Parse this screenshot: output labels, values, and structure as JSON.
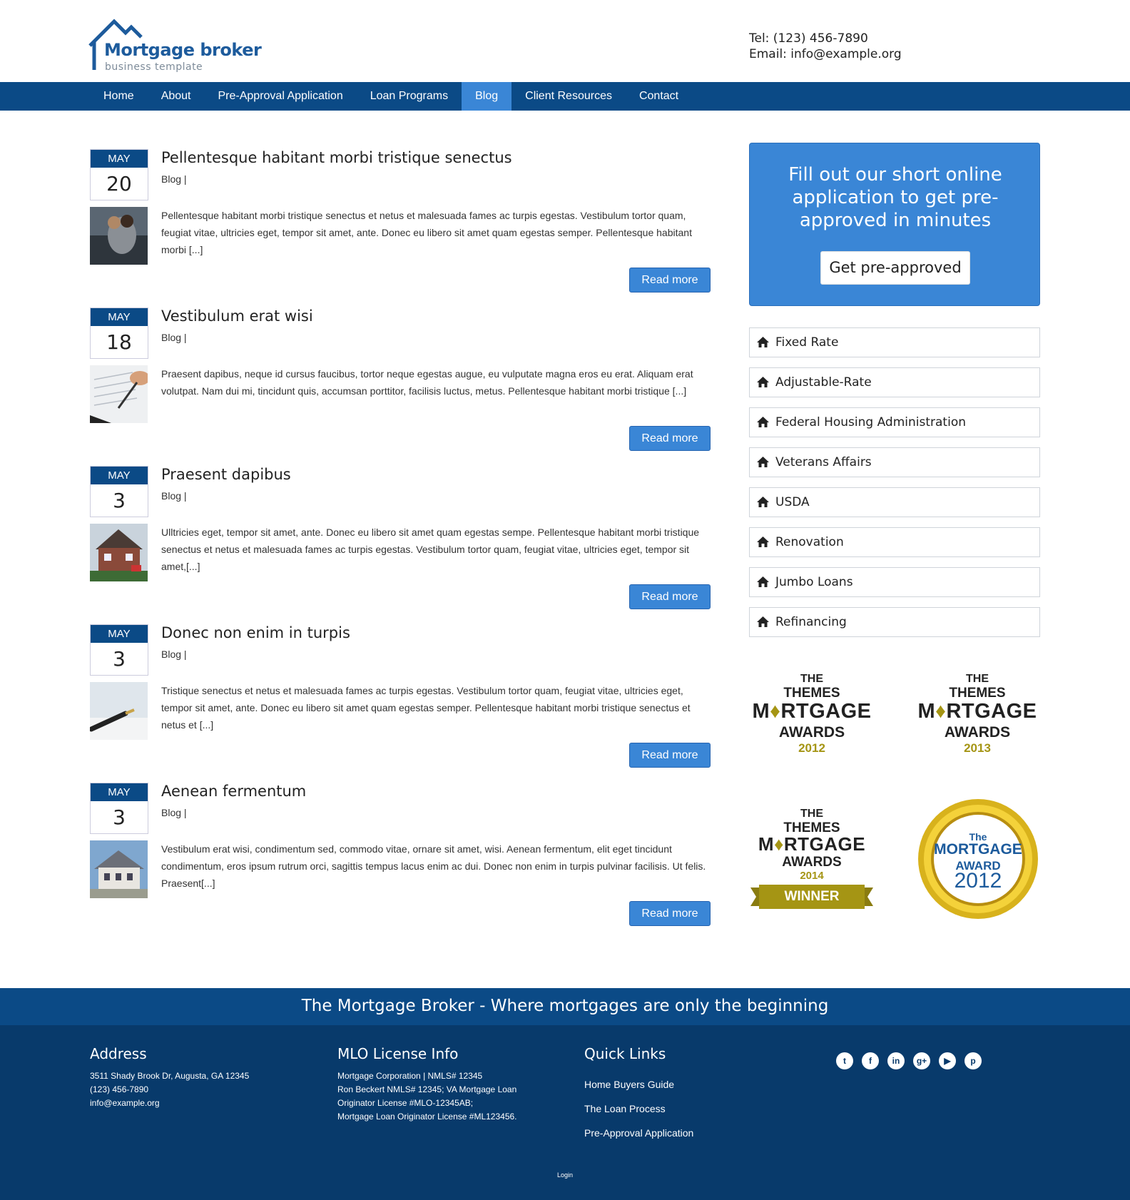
{
  "brand": {
    "title": "Mortgage broker",
    "subtitle": "business template",
    "primary_color": "#0b4a86",
    "accent_color": "#3a86d6",
    "gold_color": "#a59514"
  },
  "contact": {
    "tel": "Tel: (123) 456-7890",
    "email": "Email: info@example.org"
  },
  "nav": {
    "items": [
      {
        "label": "Home"
      },
      {
        "label": "About"
      },
      {
        "label": "Pre-Approval Application"
      },
      {
        "label": "Loan Programs"
      },
      {
        "label": "Blog",
        "active": true
      },
      {
        "label": "Client Resources"
      },
      {
        "label": "Contact"
      }
    ]
  },
  "posts": [
    {
      "month": "MAY",
      "day": "20",
      "title": "Pellentesque habitant morbi tristique senectus",
      "category": "Blog |",
      "excerpt": "Pellentesque habitant morbi tristique senectus et netus et malesuada fames ac turpis egestas. Vestibulum tortor quam, feugiat vitae, ultricies eget, tempor sit amet, ante. Donec eu libero sit amet quam egestas semper. Pellentesque habitant morbi [...]",
      "read_more": "Read more",
      "thumb_icon": "couple-photo"
    },
    {
      "month": "MAY",
      "day": "18",
      "title": "Vestibulum erat wisi",
      "category": "Blog |",
      "excerpt": "Praesent dapibus, neque id cursus faucibus, tortor neque egestas augue, eu vulputate magna eros eu erat. Aliquam erat volutpat. Nam dui mi, tincidunt quis, accumsan porttitor, facilisis luctus, metus. Pellentesque habitant morbi tristique [...]",
      "read_more": "Read more",
      "thumb_icon": "signing-document-photo"
    },
    {
      "month": "MAY",
      "day": "3",
      "title": "Praesent dapibus",
      "category": "Blog |",
      "excerpt": "Ulltricies eget, tempor sit amet, ante. Donec eu libero sit amet quam egestas sempe. Pellentesque habitant morbi tristique senectus et netus et malesuada fames ac turpis egestas. Vestibulum tortor quam, feugiat vitae, ultricies eget, tempor sit amet,[...]",
      "read_more": "Read more",
      "thumb_icon": "house-for-sale-photo"
    },
    {
      "month": "MAY",
      "day": "3",
      "title": "Donec non enim in turpis",
      "category": "Blog |",
      "excerpt": "Tristique senectus et netus et malesuada fames ac turpis egestas. Vestibulum tortor quam, feugiat vitae, ultricies eget, tempor sit amet, ante. Donec eu libero sit amet quam egestas semper. Pellentesque habitant morbi tristique senectus et netus et [...]",
      "read_more": "Read more",
      "thumb_icon": "pen-photo"
    },
    {
      "month": "MAY",
      "day": "3",
      "title": "Aenean fermentum",
      "category": "Blog |",
      "excerpt": "Vestibulum erat wisi, condimentum sed, commodo vitae, ornare sit amet, wisi. Aenean fermentum, elit eget tincidunt condimentum, eros ipsum rutrum orci, sagittis tempus lacus enim ac dui. Donec non enim in turpis pulvinar facilisis. Ut felis. Praesent[...]",
      "read_more": "Read more",
      "thumb_icon": "house-photo"
    }
  ],
  "cta": {
    "text": "Fill out our short online application to get pre-approved in minutes",
    "button": "Get pre-approved"
  },
  "loans": [
    {
      "label": "Fixed Rate"
    },
    {
      "label": "Adjustable-Rate"
    },
    {
      "label": "Federal Housing Administration"
    },
    {
      "label": "Veterans Affairs"
    },
    {
      "label": "USDA"
    },
    {
      "label": "Renovation"
    },
    {
      "label": "Jumbo Loans"
    },
    {
      "label": "Refinancing"
    }
  ],
  "awards": [
    {
      "the": "THE",
      "themes": "THEMES",
      "mortgage_left": "M",
      "mortgage_right": "RTGAGE",
      "awards": "AWARDS",
      "year": "2012"
    },
    {
      "the": "THE",
      "themes": "THEMES",
      "mortgage_left": "M",
      "mortgage_right": "RTGAGE",
      "awards": "AWARDS",
      "year": "2013"
    },
    {
      "the": "THE",
      "themes": "THEMES",
      "mortgage_left": "M",
      "mortgage_right": "RTGAGE",
      "awards": "AWARDS",
      "year": "2014",
      "ribbon": "WINNER"
    }
  ],
  "medal": {
    "the": "The",
    "mortgage": "MORTGAGE",
    "award": "AWARD",
    "year": "2012"
  },
  "footer": {
    "tagline": "The Mortgage Broker - Where mortgages are only the beginning",
    "address": {
      "heading": "Address",
      "lines": [
        "3511 Shady Brook Dr, Augusta, GA 12345",
        "(123) 456-7890",
        "info@example.org"
      ]
    },
    "license": {
      "heading": "MLO License Info",
      "lines": [
        "Mortgage Corporation | NMLS# 12345",
        "Ron Beckert NMLS# 12345; VA Mortgage Loan",
        "Originator License #MLO-12345AB;",
        "Mortgage Loan Originator License #ML123456."
      ]
    },
    "quick_links": {
      "heading": "Quick Links",
      "links": [
        {
          "label": "Home Buyers Guide"
        },
        {
          "label": "The Loan Process"
        },
        {
          "label": "Pre-Approval Application"
        }
      ]
    },
    "social": [
      {
        "icon": "twitter-icon",
        "glyph": "t"
      },
      {
        "icon": "facebook-icon",
        "glyph": "f"
      },
      {
        "icon": "linkedin-icon",
        "glyph": "in"
      },
      {
        "icon": "google-plus-icon",
        "glyph": "g+"
      },
      {
        "icon": "youtube-icon",
        "glyph": "▶"
      },
      {
        "icon": "pinterest-icon",
        "glyph": "p"
      }
    ],
    "login": "Login"
  }
}
